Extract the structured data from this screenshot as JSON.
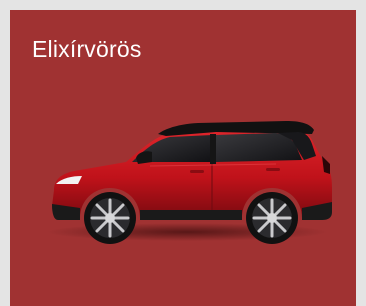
{
  "color_option": {
    "name": "Elixírvörös",
    "swatch_background": "#a03232",
    "image": "red-compact-suv-side-view"
  },
  "colors": {
    "page_background": "#e4e4e4",
    "car_body": "#c8141c",
    "roof": "#111111"
  }
}
